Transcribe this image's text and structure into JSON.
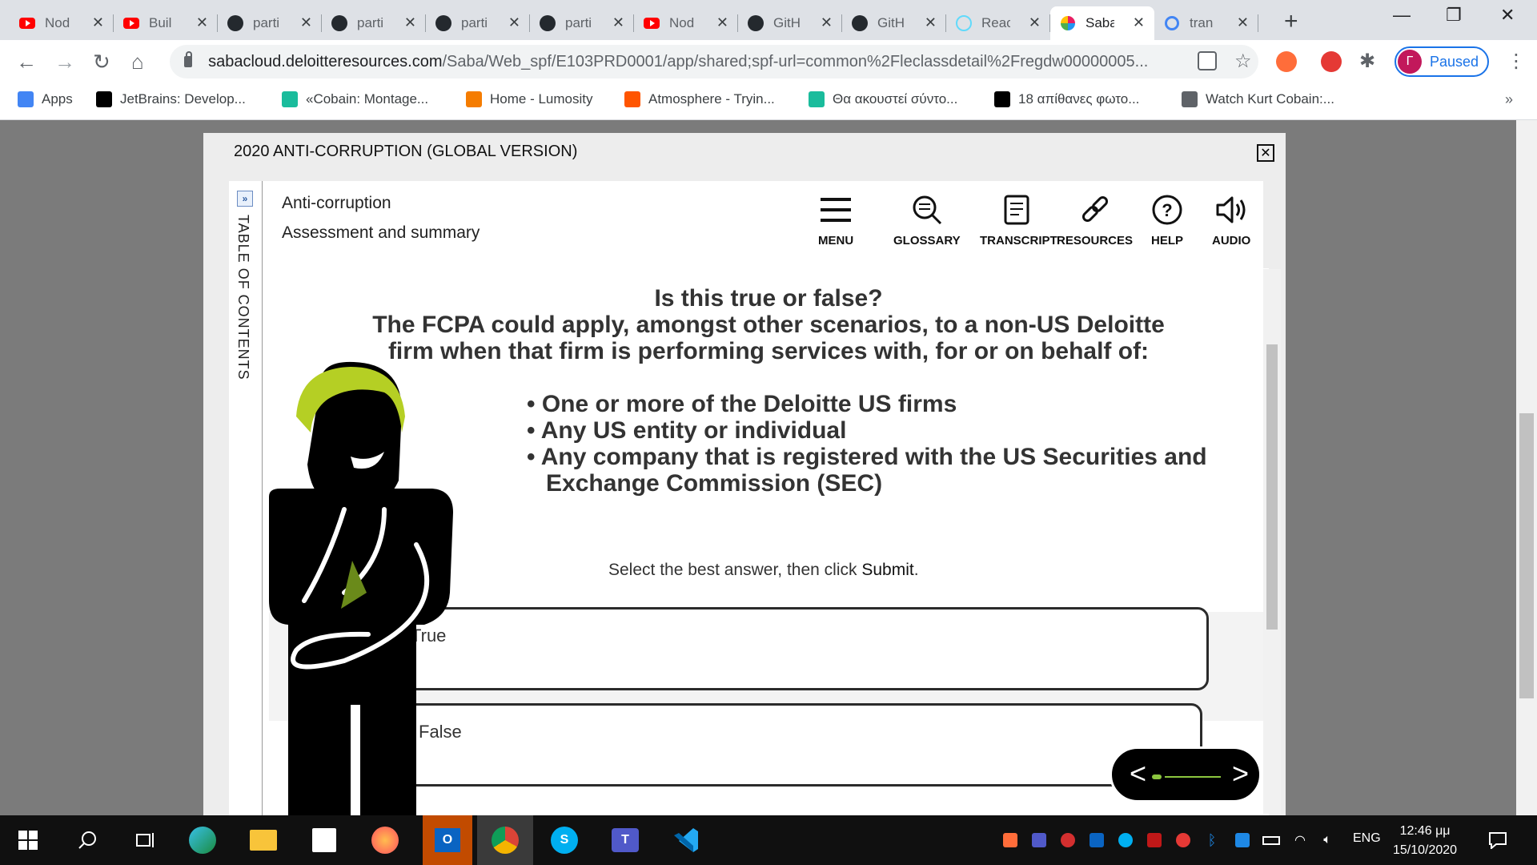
{
  "browser": {
    "tabs": [
      {
        "title": "Nod",
        "icon": "youtube-icon"
      },
      {
        "title": "Buil",
        "icon": "youtube-icon"
      },
      {
        "title": "parti",
        "icon": "github-icon"
      },
      {
        "title": "parti",
        "icon": "github-icon"
      },
      {
        "title": "parti",
        "icon": "github-icon"
      },
      {
        "title": "parti",
        "icon": "github-icon"
      },
      {
        "title": "Nod",
        "icon": "youtube-icon"
      },
      {
        "title": "GitH",
        "icon": "github-icon"
      },
      {
        "title": "GitH",
        "icon": "github-icon"
      },
      {
        "title": "Reac",
        "icon": "react-icon"
      },
      {
        "title": "Saba",
        "icon": "saba-icon",
        "active": true
      },
      {
        "title": "tran",
        "icon": "google-icon"
      }
    ],
    "url_host": "sabacloud.deloitteresources.com",
    "url_path": "/Saba/Web_spf/E103PRD0001/app/shared;spf-url=common%2Fleclassdetail%2Fregdw00000005...",
    "profile_initial": "Г",
    "profile_status": "Paused",
    "bookmarks": [
      {
        "label": "Apps",
        "color": "#4285f4"
      },
      {
        "label": "JetBrains: Develop...",
        "color": "#000000"
      },
      {
        "label": "«Cobain: Montage...",
        "color": "#1abc9c"
      },
      {
        "label": "Home - Lumosity",
        "color": "#f57c00"
      },
      {
        "label": "Atmosphere - Tryin...",
        "color": "#ff5500"
      },
      {
        "label": "Θα ακουστεί σύντο...",
        "color": "#1abc9c"
      },
      {
        "label": "18 απίθανες φωτο...",
        "color": "#000000"
      },
      {
        "label": "Watch Kurt Cobain:...",
        "color": "#5f6368"
      }
    ]
  },
  "modal": {
    "title": "2020 ANTI-CORRUPTION (GLOBAL VERSION)",
    "toc_label": "TABLE OF CONTENTS",
    "breadcrumb_course": "Anti-corruption",
    "breadcrumb_section": "Assessment and summary",
    "tools": [
      {
        "label": "MENU",
        "icon": "menu-icon"
      },
      {
        "label": "GLOSSARY",
        "icon": "glossary-icon"
      },
      {
        "label": "TRANSCRIPT",
        "icon": "transcript-icon"
      },
      {
        "label": "RESOURCES",
        "icon": "resources-icon"
      },
      {
        "label": "HELP",
        "icon": "help-icon"
      },
      {
        "label": "AUDIO",
        "icon": "audio-icon"
      }
    ],
    "question_heading": "Is this true or false?",
    "question_text": "The FCPA could apply, amongst other scenarios, to a non-US Deloitte firm when that firm is performing services with, for or on behalf of:",
    "bullets": [
      "One or more of the Deloitte US firms",
      "Any US entity or individual",
      "Any company that is registered with the US Securities and Exchange Commission (SEC)"
    ],
    "instruction_prefix": "Select the best answer, then click ",
    "instruction_action": "Submit",
    "instruction_suffix": ".",
    "options": [
      "True",
      "False"
    ],
    "accent_color": "#8cc63f",
    "character_hair_color": "#b5cf24"
  },
  "taskbar": {
    "language": "ENG",
    "time": "12:46 μμ",
    "date": "15/10/2020"
  }
}
